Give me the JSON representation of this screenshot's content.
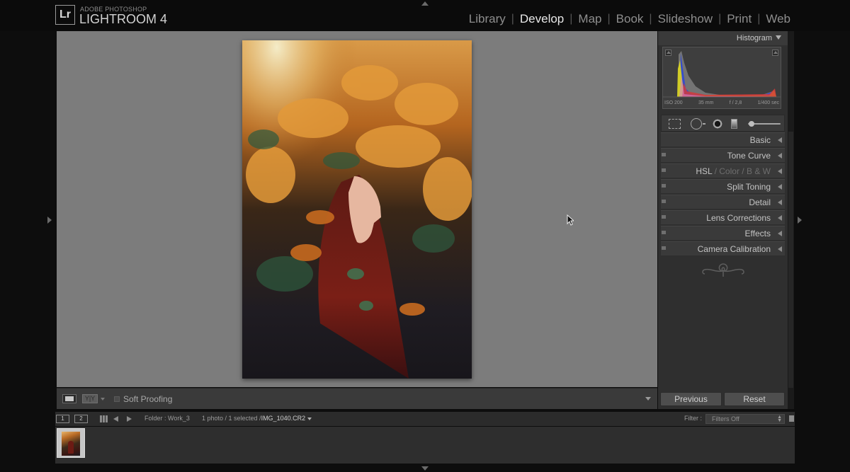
{
  "app": {
    "brand_small": "ADOBE PHOTOSHOP",
    "brand_name": "LIGHTROOM 4",
    "logo_text": "Lr"
  },
  "modules": [
    {
      "label": "Library",
      "active": false
    },
    {
      "label": "Develop",
      "active": true
    },
    {
      "label": "Map",
      "active": false
    },
    {
      "label": "Book",
      "active": false
    },
    {
      "label": "Slideshow",
      "active": false
    },
    {
      "label": "Print",
      "active": false
    },
    {
      "label": "Web",
      "active": false
    }
  ],
  "separator": "|",
  "toolbar": {
    "view_yy": "Y|Y",
    "soft_proofing": "Soft Proofing"
  },
  "histogram": {
    "title": "Histogram",
    "exif": {
      "iso": "ISO 200",
      "focal": "35 mm",
      "aperture": "f / 2,8",
      "shutter": "1/400 sec"
    }
  },
  "panels": {
    "basic": "Basic",
    "tone_curve": "Tone Curve",
    "hsl": "HSL",
    "hsl_sep": "/",
    "color": "Color",
    "bw": "B & W",
    "split_toning": "Split Toning",
    "detail": "Detail",
    "lens_corrections": "Lens Corrections",
    "effects": "Effects",
    "camera_calibration": "Camera Calibration"
  },
  "buttons": {
    "previous": "Previous",
    "reset": "Reset"
  },
  "filmstrip": {
    "page1": "1",
    "page2": "2",
    "folder": "Folder : Work_3",
    "count": "1 photo / 1 selected /",
    "filename": "IMG_1040.CR2",
    "filter_label": "Filter :",
    "filter_value": "Filters Off"
  },
  "colors": {
    "background": "#0d0d0d",
    "canvas": "#7c7c7c",
    "panel": "#2f2f2f",
    "active_module": "#e8e8e8",
    "inactive_module": "#8e8e8e"
  }
}
